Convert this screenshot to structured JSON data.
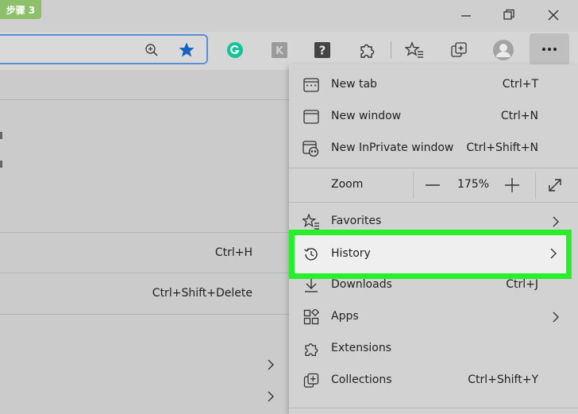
{
  "badge": "步骤 3",
  "page_rows": [
    {
      "shortcut": "Ctrl+H"
    },
    {
      "shortcut": "Ctrl+Shift+Delete"
    }
  ],
  "menu": {
    "items": [
      {
        "name": "new-tab",
        "label": "New tab",
        "shortcut": "Ctrl+T",
        "icon": "new-tab-icon"
      },
      {
        "name": "new-window",
        "label": "New window",
        "shortcut": "Ctrl+N",
        "icon": "window-icon"
      },
      {
        "name": "new-inprivate",
        "label": "New InPrivate window",
        "shortcut": "Ctrl+Shift+N",
        "icon": "inprivate-icon"
      }
    ],
    "zoom": {
      "label": "Zoom",
      "value": "175%",
      "minus": "—",
      "plus": "+"
    },
    "favorites": {
      "label": "Favorites",
      "icon": "favorites-icon"
    },
    "history": {
      "label": "History",
      "icon": "history-icon"
    },
    "lower_items": [
      {
        "name": "downloads",
        "label": "Downloads",
        "shortcut": "Ctrl+J",
        "icon": "download-icon"
      },
      {
        "name": "apps",
        "label": "Apps",
        "shortcut": "",
        "icon": "apps-icon"
      },
      {
        "name": "extensions",
        "label": "Extensions",
        "shortcut": "",
        "icon": "extensions-icon"
      },
      {
        "name": "collections",
        "label": "Collections",
        "shortcut": "Ctrl+Shift+Y",
        "icon": "collections-icon"
      }
    ]
  },
  "colors": {
    "highlight": "#27f02a",
    "star": "#1565c0",
    "grammarly": "#15c39a",
    "address_border": "#5a8fd6"
  }
}
